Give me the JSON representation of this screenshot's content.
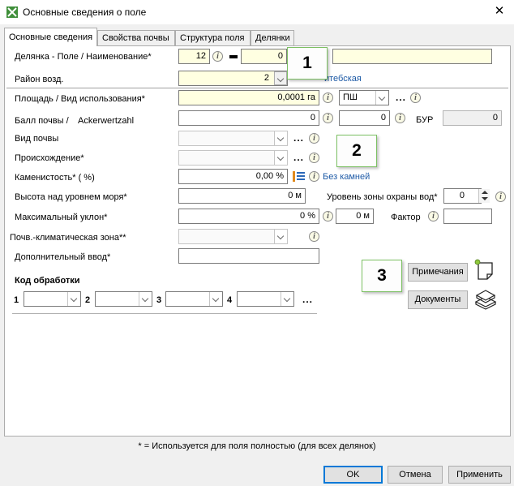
{
  "window": {
    "title": "Основные сведения о поле",
    "close": "✕"
  },
  "tabs": [
    "Основные сведения",
    "Свойства почвы",
    "Структура поля",
    "Делянки"
  ],
  "fields": {
    "plot_label": "Делянка - Поле / Наименование*",
    "plot_number": "12",
    "plot_field": "0",
    "plot_name": "",
    "district_label": "Район возд.",
    "district_value": "2",
    "district_link": "итебская",
    "area_label": "Площадь / Вид использования*",
    "area_value": "0,0001 га",
    "usage_value": "ПШ",
    "soil_score_label": "Балл почвы /",
    "soil_score_sub": "Ackerwertzahl",
    "soil_score_value": "0",
    "soil_score_value2": "0",
    "bur_label": "БУР",
    "bur_value": "0",
    "soil_type_label": "Вид почвы",
    "origin_label": "Происхождение*",
    "stoniness_label": "Каменистость* ( %)",
    "stoniness_value": "0,00 %",
    "stoniness_link": "Без камней",
    "altitude_label": "Высота над уровнем моря*",
    "altitude_value": "0 м",
    "water_zone_label": "Уровень зоны охраны вод*",
    "water_zone_value": "0",
    "slope_label": "Максимальный уклон*",
    "slope_value": "0 %",
    "slope_m_value": "0 м",
    "factor_label": "Фактор",
    "factor_value": "",
    "climate_label": "Почв.-климатическая зона**",
    "extra_label": "Дополнительный ввод*",
    "extra_value": ""
  },
  "codes": {
    "title": "Код обработки",
    "n1": "1",
    "n2": "2",
    "n3": "3",
    "n4": "4",
    "more": "..."
  },
  "buttons": {
    "notes": "Примечания",
    "documents": "Документы",
    "ok": "OK",
    "cancel": "Отмена",
    "apply": "Применить"
  },
  "callouts": [
    "1",
    "2",
    "3"
  ],
  "footnote": "* = Используется для поля полностью (для всех делянок)",
  "icons": {
    "info": "i",
    "dots": "..."
  }
}
